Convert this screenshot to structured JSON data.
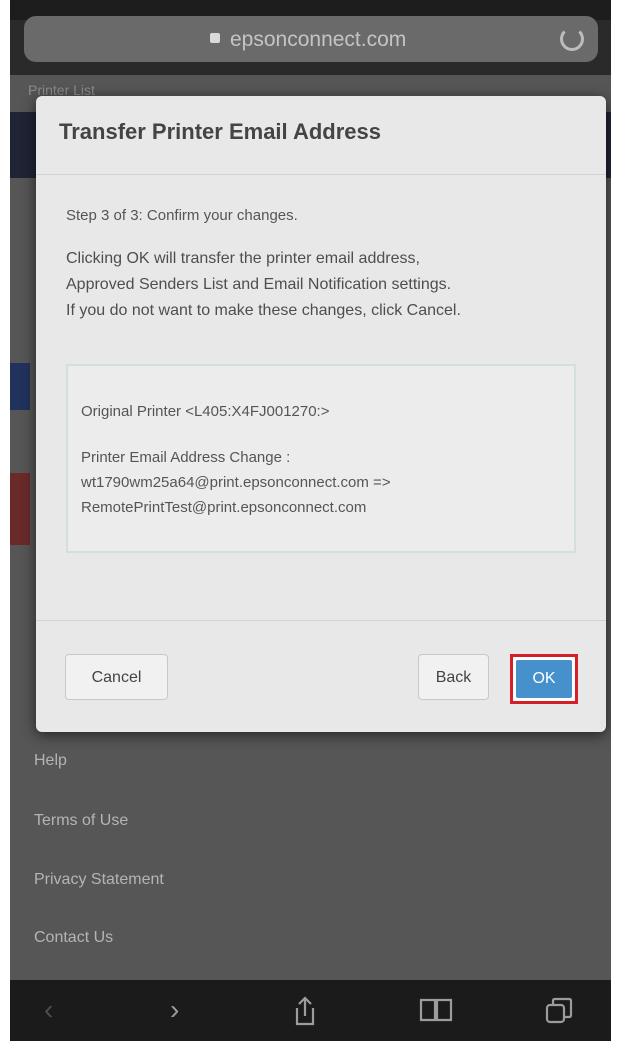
{
  "browser": {
    "url": "epsonconnect.com"
  },
  "background_page": {
    "title": "Printer List"
  },
  "dialog": {
    "title": "Transfer Printer Email Address",
    "step": "Step 3 of 3: Confirm your changes.",
    "description_lines": [
      "Clicking OK will transfer the printer email address,",
      "Approved Senders List and Email Notification settings.",
      "If you do not want to make these changes, click Cancel."
    ],
    "original_printer": "Original Printer <L405:X4FJ001270:>",
    "change_label": "Printer Email Address Change :",
    "old_email": "wt1790wm25a64@print.epsonconnect.com =>",
    "new_email": "RemotePrintTest@print.epsonconnect.com",
    "buttons": {
      "cancel": "Cancel",
      "back": "Back",
      "ok": "OK"
    }
  },
  "footer_links": [
    "Help",
    "Terms of Use",
    "Privacy Statement",
    "Contact Us"
  ],
  "toolbar_icons": [
    "back-arrow-icon",
    "forward-arrow-icon",
    "share-icon",
    "bookmarks-icon",
    "tabs-icon"
  ],
  "colors": {
    "ok_button": "#4690cc",
    "highlight": "#d32027"
  }
}
